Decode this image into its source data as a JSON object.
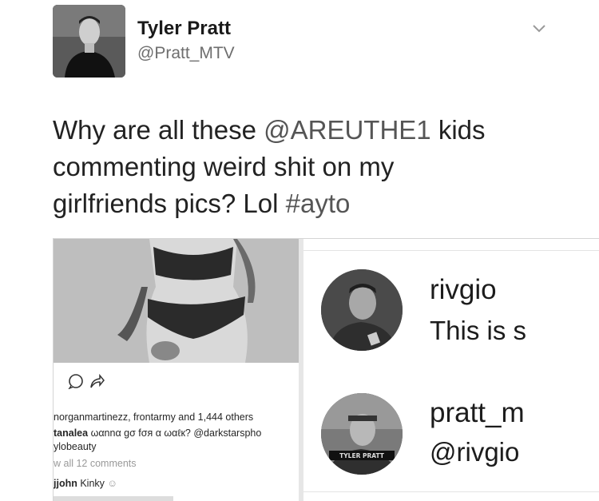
{
  "tweet": {
    "author_name": "Tyler Pratt",
    "author_handle": "@Pratt_MTV",
    "line1_pre": "Why are all these ",
    "line1_mention": "@AREUTHE1",
    "line1_post": " kids",
    "line2": "commenting weird shit on my",
    "line3_pre": "girlfriends pics? Lol ",
    "line3_hashtag": "#ayto"
  },
  "icons": {
    "header": [
      "chevron-down-icon"
    ],
    "instagram": [
      "comment-icon",
      "share-icon"
    ]
  },
  "instagram_post": {
    "likes": "norganmartinezz, frontarmy and 1,444 others",
    "comment1_user": "tanalea",
    "comment1_text": " ωαnnα gσ fσя α ωαℓк? @darkstarsphο",
    "comment1_cont": "ylobeauty",
    "view_all": "w all 12 comments",
    "comment2_user": "jjohn",
    "comment2_text": " Kinky",
    "emoji": "☺"
  },
  "instagram_comments": [
    {
      "username": "rivgio",
      "text": "This is s"
    },
    {
      "username": "pratt_m",
      "text": "@rivgio"
    }
  ],
  "avatar_badge_text": "TYLER PRATT",
  "colors": {
    "background": "#ffffff",
    "text": "#1c1c1c",
    "muted": "#6e6e6e"
  }
}
